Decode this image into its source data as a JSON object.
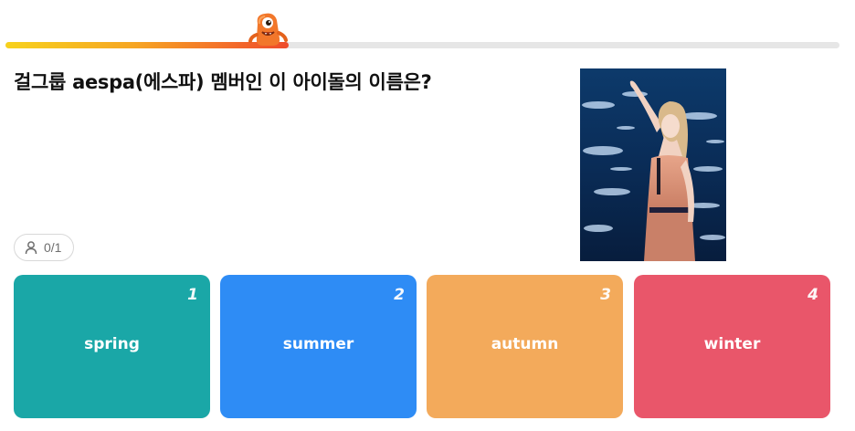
{
  "progress": {
    "fraction": 0.34,
    "mascot_icon": "orange-monster-mascot-icon"
  },
  "question": {
    "text": "걸그룹 aespa(에스파) 멤버인 이 아이돌의 이름은?"
  },
  "answers": {
    "count_text": "0/1",
    "icon": "user-icon"
  },
  "options": [
    {
      "number": "1",
      "label": "spring",
      "color": "#1aa7a7"
    },
    {
      "number": "2",
      "label": "summer",
      "color": "#2e8cf5"
    },
    {
      "number": "3",
      "label": "autumn",
      "color": "#f3aa5b"
    },
    {
      "number": "4",
      "label": "winter",
      "color": "#e9566a"
    }
  ],
  "colors": {
    "progress_track": "#e6e6e6",
    "progress_start": "#f7d21d",
    "progress_end": "#ee4b2b"
  }
}
